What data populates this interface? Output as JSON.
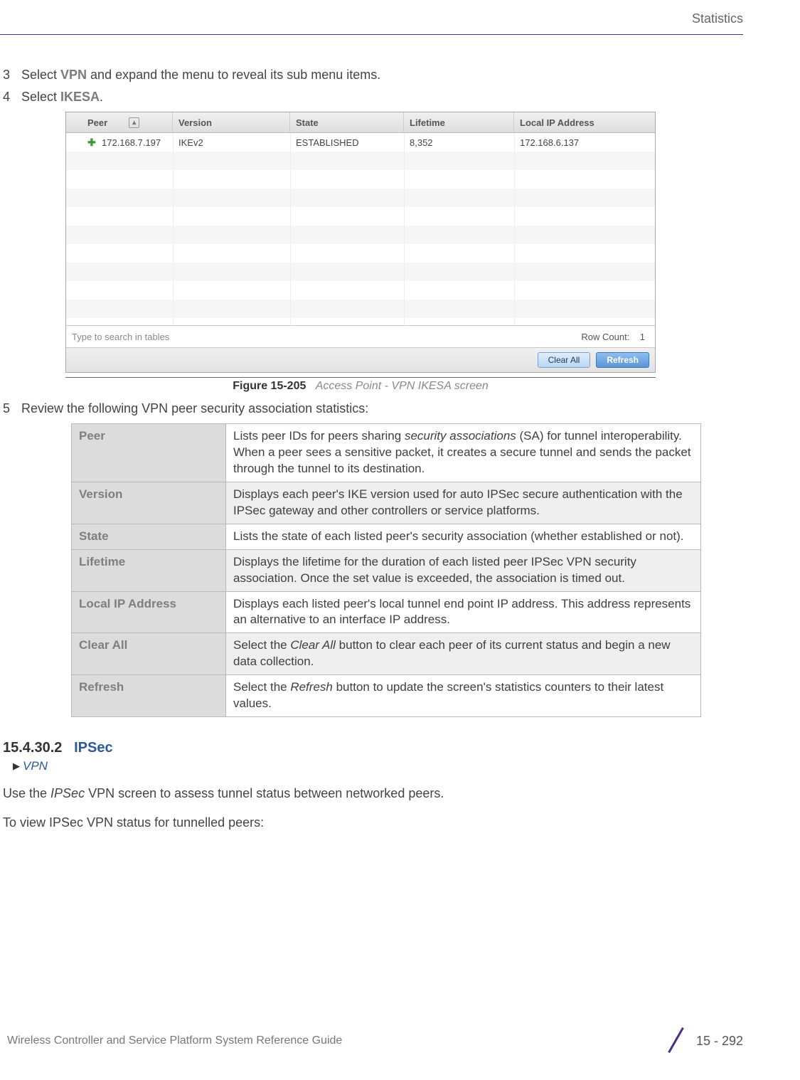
{
  "header": {
    "chapter": "Statistics"
  },
  "steps": {
    "s3_num": "3",
    "s3_pre": "Select ",
    "s3_bold": "VPN",
    "s3_post": " and expand the menu to reveal its sub menu items.",
    "s4_num": "4",
    "s4_pre": "Select ",
    "s4_bold": "IKESA",
    "s4_post": ".",
    "s5_num": "5",
    "s5_text": "Review the following VPN peer security association statistics:"
  },
  "screenshot": {
    "headers": {
      "peer": "Peer",
      "version": "Version",
      "state": "State",
      "lifetime": "Lifetime",
      "local_ip": "Local IP Address"
    },
    "row": {
      "peer": "172.168.7.197",
      "version": "IKEv2",
      "state": "ESTABLISHED",
      "lifetime": "8,352",
      "local_ip": "172.168.6.137"
    },
    "search_placeholder": "Type to search in tables",
    "row_count_label": "Row Count:",
    "row_count_value": "1",
    "clear_all": "Clear All",
    "refresh": "Refresh"
  },
  "figure": {
    "num": "Figure 15-205",
    "title": "Access Point - VPN IKESA screen"
  },
  "defs": {
    "r1_label": "Peer",
    "r1_text_a": "Lists peer IDs for peers sharing ",
    "r1_text_em": "security associations",
    "r1_text_b": " (SA) for tunnel interoperability. When a peer sees a sensitive packet, it creates a secure tunnel and sends the packet through the tunnel to its destination.",
    "r2_label": "Version",
    "r2_text": "Displays each peer's IKE version used for auto IPSec secure authentication with the IPSec gateway and other controllers or service platforms.",
    "r3_label": "State",
    "r3_text": "Lists the state of each listed peer's security association (whether established or not).",
    "r4_label": "Lifetime",
    "r4_text": "Displays the lifetime for the duration of each listed peer IPSec VPN security association. Once the set value is exceeded, the association is timed out.",
    "r5_label": "Local IP Address",
    "r5_text": "Displays each listed peer's local tunnel end point IP address. This address represents an alternative to an interface IP address.",
    "r6_label": "Clear All",
    "r6_text_a": "Select the ",
    "r6_text_em": "Clear All",
    "r6_text_b": " button to clear each peer of its current status and begin a new data collection.",
    "r7_label": "Refresh",
    "r7_text_a": "Select the ",
    "r7_text_em": "Refresh",
    "r7_text_b": " button to update the screen's statistics counters to their latest values."
  },
  "section": {
    "num": "15.4.30.2",
    "title": "IPSec",
    "breadcrumb": "VPN"
  },
  "paras": {
    "p1_a": "Use the ",
    "p1_em": "IPSec",
    "p1_b": " VPN screen to assess tunnel status between networked peers.",
    "p2": "To view IPSec VPN status for tunnelled peers:"
  },
  "footer": {
    "guide": "Wireless Controller and Service Platform System Reference Guide",
    "pagenum": "15 - 292"
  }
}
